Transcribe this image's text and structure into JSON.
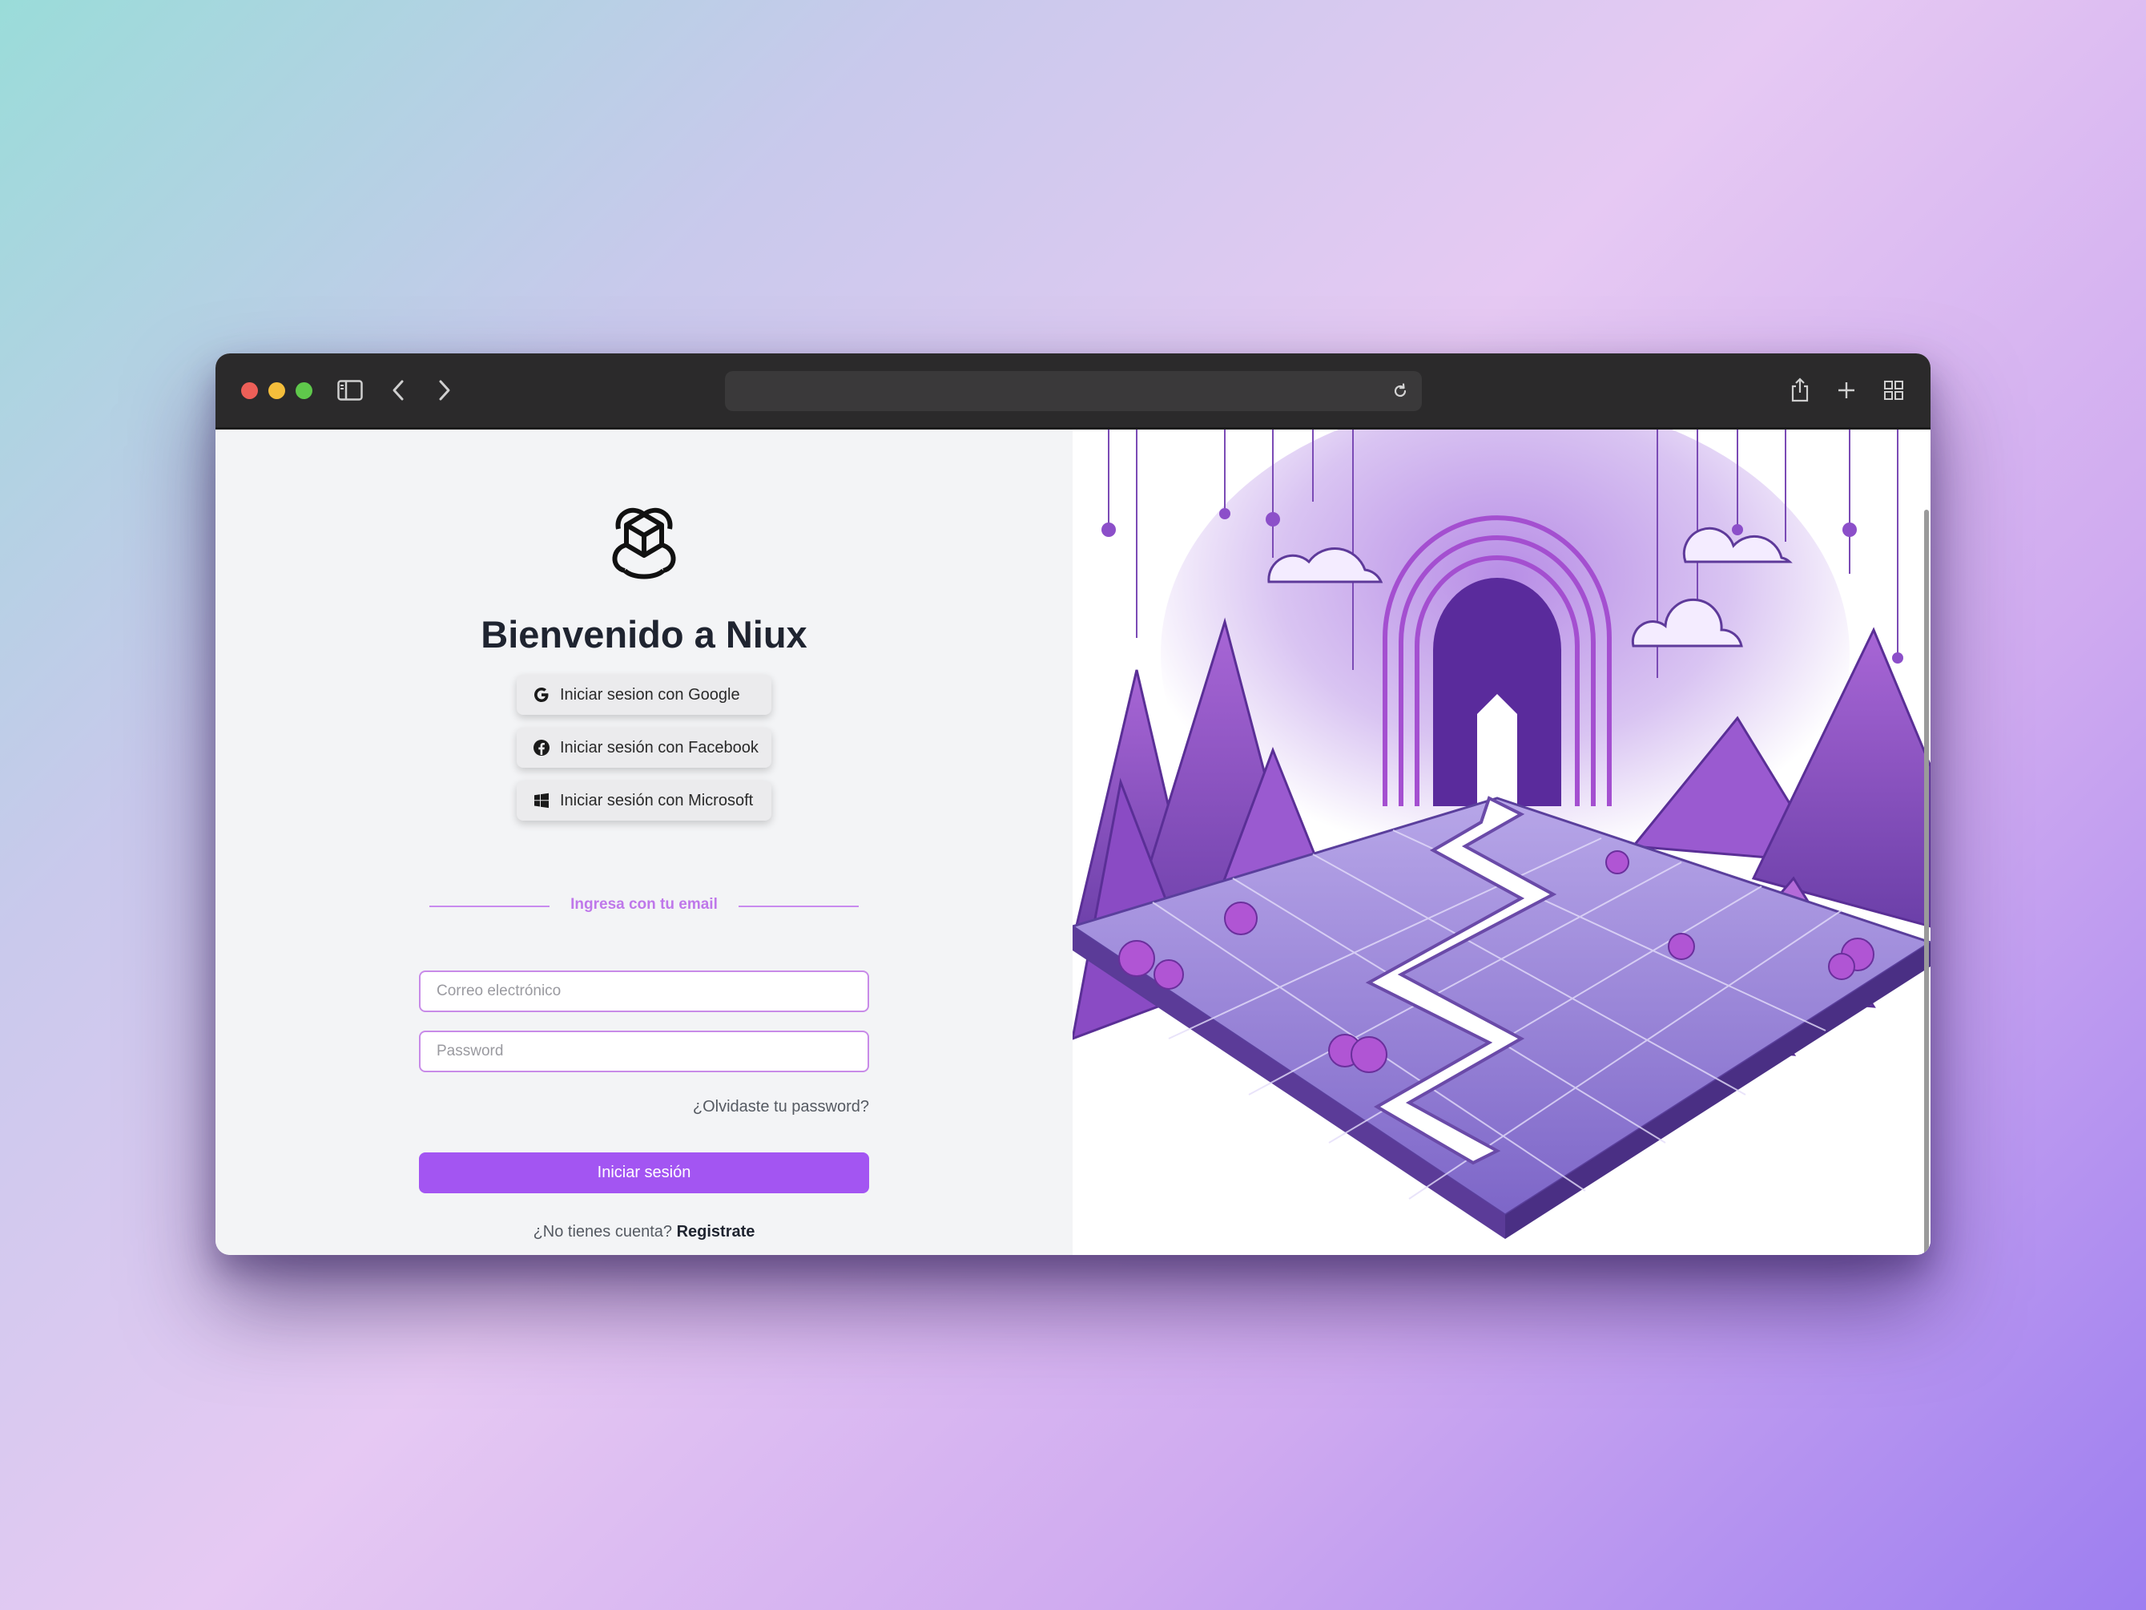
{
  "browser": {
    "url": "",
    "icons": [
      "sidebar-icon",
      "back-icon",
      "forward-icon",
      "reload-icon",
      "share-icon",
      "new-tab-icon",
      "tab-overview-icon"
    ]
  },
  "login": {
    "title": "Bienvenido a Niux",
    "social": {
      "google": "Iniciar sesion con Google",
      "facebook": "Iniciar sesión con Facebook",
      "microsoft": "Iniciar sesión con Microsoft"
    },
    "divider_text": "Ingresa con tu email",
    "email_placeholder": "Correo electrónico",
    "password_placeholder": "Password",
    "forgot_label": "¿Olvidaste tu password?",
    "submit_label": "Iniciar sesión",
    "signup_prompt": "¿No tienes cuenta?",
    "signup_link": "Registrate"
  },
  "colors": {
    "accent": "#a355f2",
    "field_border": "#c88be8",
    "divider": "#bf78ea",
    "titlebar": "#2b2a2b"
  }
}
